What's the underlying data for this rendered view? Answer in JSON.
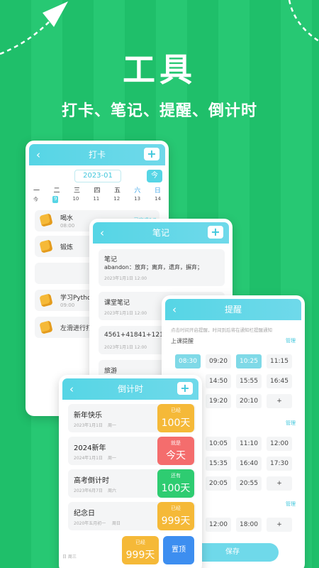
{
  "hero": {
    "title": "工具",
    "subtitle": "打卡、笔记、提醒、倒计时"
  },
  "colors": {
    "bg": "#1fbf6a",
    "accent": "#56d5e5",
    "orange": "#f5b938",
    "red": "#f46d6d",
    "green": "#2ecc71"
  },
  "checkin": {
    "title": "打卡",
    "month": "2023-01",
    "today_btn": "今",
    "weekdays": [
      "一",
      "二",
      "三",
      "四",
      "五",
      "六",
      "日"
    ],
    "dates": [
      "今",
      "9",
      "10",
      "11",
      "12",
      "13",
      "14"
    ],
    "items": [
      {
        "name": "喝水",
        "time": "08:00",
        "status": "已完成0/3"
      },
      {
        "name": "锻炼",
        "time": "",
        "status": ""
      },
      {
        "name": "",
        "time": "",
        "status": ""
      },
      {
        "name": "学习Python",
        "time": "09:00",
        "status": ""
      },
      {
        "name": "左滑进行打卡",
        "time": "",
        "status": ""
      }
    ]
  },
  "notes": {
    "title": "笔记",
    "items": [
      {
        "title": "笔记",
        "body": "abandon：放弃；离弃，遗弃，摒弃；",
        "date": "2023年1月1日 12:00"
      },
      {
        "title": "课堂笔记",
        "body": "",
        "date": "2023年1月1日 12:00"
      },
      {
        "title": "4561+41841+121",
        "body": "",
        "date": "2023年1月1日 12:00"
      },
      {
        "title": "旅游",
        "body": "",
        "date": ""
      }
    ]
  },
  "reminder": {
    "title": "提醒",
    "hint": "点击时间开启提醒，时间到后将在通知栏提醒通知",
    "sections": [
      {
        "name": "上课提醒",
        "manage": "管理",
        "rows": [
          [
            "08:30",
            "09:20",
            "10:25",
            "11:15"
          ],
          [
            "",
            "14:50",
            "15:55",
            "16:45"
          ],
          [
            "",
            "19:20",
            "20:10",
            "+"
          ]
        ]
      },
      {
        "name": "",
        "manage": "管理",
        "rows": [
          [
            "",
            "10:05",
            "11:10",
            "12:00"
          ],
          [
            "",
            "15:35",
            "16:40",
            "17:30"
          ],
          [
            "",
            "20:05",
            "20:55",
            "+"
          ]
        ]
      },
      {
        "name": "",
        "manage": "管理",
        "rows": [
          [
            "",
            "12:00",
            "18:00",
            "+"
          ]
        ]
      }
    ],
    "save": "保存"
  },
  "countdown": {
    "title": "倒计时",
    "items": [
      {
        "name": "新年快乐",
        "date": "2023年1月1日",
        "weekday": "周一",
        "label": "已经",
        "value": "100天",
        "kind": "orange"
      },
      {
        "name": "2024新年",
        "date": "2024年1月1日",
        "weekday": "周一",
        "label": "就是",
        "value": "今天",
        "kind": "red"
      },
      {
        "name": "高考倒计时",
        "date": "2023年6月7日",
        "weekday": "周六",
        "label": "还有",
        "value": "100天",
        "kind": "green"
      },
      {
        "name": "纪念日",
        "date": "2020年五月初一",
        "weekday": "周日",
        "label": "已经",
        "value": "999天",
        "kind": "orange"
      }
    ],
    "footer": {
      "weekday": "日  周三",
      "label": "已经",
      "value": "999天",
      "pin": "置顶"
    }
  }
}
